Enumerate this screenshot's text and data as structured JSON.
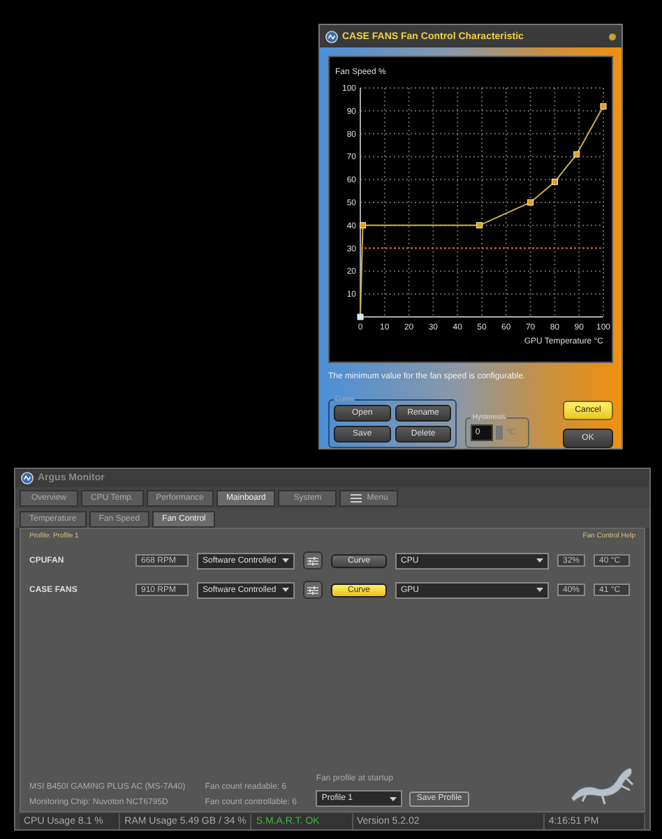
{
  "dialog": {
    "title": "CASE FANS Fan Control Characteristic",
    "chart_data": {
      "type": "line",
      "xlabel": "GPU Temperature °C",
      "ylabel": "Fan Speed %",
      "x": [
        0,
        1,
        49,
        70,
        80,
        89,
        100
      ],
      "series": [
        {
          "color": "#c8b04a",
          "marker": "square",
          "values": [
            0,
            40,
            40,
            50,
            59,
            71,
            92
          ]
        }
      ],
      "grid": true,
      "xlim": [
        0,
        100
      ],
      "ylim": [
        0,
        100
      ],
      "xticks": [
        0,
        10,
        20,
        30,
        40,
        50,
        60,
        70,
        80,
        90,
        100
      ],
      "yticks": [
        10,
        20,
        30,
        40,
        50,
        60,
        70,
        80,
        90,
        100
      ],
      "ref_lines": [
        {
          "axis": "y",
          "value": 30,
          "color": "#d06020"
        }
      ]
    },
    "hint": "The minimum value for the fan speed is configurable.",
    "curve_group": {
      "legend": "Curve",
      "buttons": [
        "Open",
        "Rename",
        "Save",
        "Delete"
      ]
    },
    "hysteresis": {
      "legend": "Hysteresis",
      "value": "0",
      "unit": "°C"
    },
    "buttons": [
      {
        "label": "Cancel",
        "selected": true
      },
      {
        "label": "OK",
        "selected": false
      }
    ]
  },
  "window": {
    "title": "Argus Monitor",
    "tabs": [
      {
        "label": "Overview",
        "selected": false
      },
      {
        "label": "CPU Temp.",
        "selected": false
      },
      {
        "label": "Performance",
        "selected": false
      },
      {
        "label": "Mainboard",
        "selected": true
      },
      {
        "label": "System",
        "selected": false
      },
      {
        "label": "Menu",
        "selected": false,
        "kind": "menu"
      }
    ],
    "subtabs": [
      {
        "label": "Temperature",
        "selected": false
      },
      {
        "label": "Fan Speed",
        "selected": false
      },
      {
        "label": "Fan Control",
        "selected": true
      }
    ],
    "profile": "Profile: Profile 1",
    "help_link": "Fan Control Help",
    "fans": [
      {
        "name": "CPUFAN",
        "rpm": "668 RPM",
        "mode": "Software Controlled",
        "curve": "Curve",
        "curve_active": false,
        "source": "CPU",
        "percent": "32%",
        "temp": "40 °C"
      },
      {
        "name": "CASE FANS",
        "rpm": "910 RPM",
        "mode": "Software Controlled",
        "curve": "Curve",
        "curve_active": true,
        "source": "GPU",
        "percent": "40%",
        "temp": "41 °C"
      }
    ],
    "board": "MSI B450I GAMING PLUS AC (MS-7A40)",
    "chip": "Monitoring Chip: Nuvoton NCT6795D",
    "readable": "Fan count readable: 6",
    "controllable": "Fan count controllable: 6",
    "startup_label": "Fan profile at startup",
    "startup_profile": "Profile 1",
    "save_profile": "Save Profile",
    "status_bar": [
      {
        "text": "CPU Usage 8.1 %",
        "kind": "info"
      },
      {
        "text": "RAM Usage 5.49 GB / 34 %",
        "kind": "info"
      },
      {
        "text": "S.M.A.R.T. OK",
        "kind": "ok"
      },
      {
        "text": "Version 5.2.02",
        "kind": "info"
      },
      {
        "text": "4:16:51 PM",
        "kind": "info"
      }
    ]
  }
}
